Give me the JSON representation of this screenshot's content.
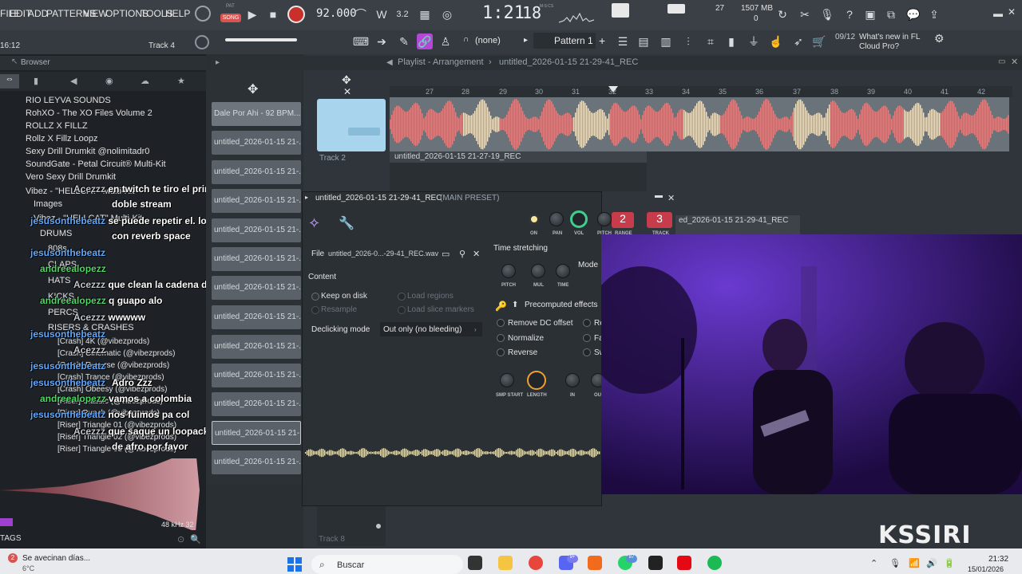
{
  "menu": {
    "items": [
      "FILE",
      "EDIT",
      "ADD",
      "PATTERNS",
      "VIEW",
      "OPTIONS",
      "TOOLS",
      "HELP"
    ],
    "song_mode": "SONG",
    "pat_label": "PAT",
    "tempo": "92.000",
    "time": "1:21",
    "time_ms": "18",
    "time_unit": "M:S:CS",
    "cpu_num": "27",
    "mem": "1507 MB",
    "mem2": "0",
    "hint_counter": "09/12",
    "hint_text": "What's new in FL Cloud Pro?"
  },
  "toolbar2": {
    "left_time": "16:12",
    "track_label": "Track 4",
    "snap": "(none)",
    "pattern": "Pattern 1"
  },
  "browser": {
    "title": "Browser",
    "items": [
      "RIO LEYVA SOUNDS",
      "RohXO - The XO Files Volume 2",
      "ROLLZ X FILLZ",
      "Rollz X Fillz Loopz",
      "Sexy Drill Drumkit @nolimitadr0",
      "SoundGate - Petal Circuit® Multi-Kit",
      "Vero Sexy Drill Drumkit",
      "Vibez - \"HELLCAT\" Multi-Kit",
      "Images",
      "Vibez - \"HELLCAT\" Multi-Kit",
      "DRUMS",
      "808s",
      "CLAPS",
      "HATS",
      "KICKS",
      "PERCS",
      "RISERS & CRASHES",
      "[Crash] 4K (@vibezprods)",
      "[Crash] Cinematic (@vibezprods)",
      "[Crash] Reverse (@vibezprods)",
      "[Crash] Trance (@vibezprods)",
      "[Crash] Obeesy (@vibezprods)",
      "[Riser] Classic (@vibezprods)",
      "[Riser] Punch (@vibezprods)",
      "[Riser] Triangle 01 (@vibezprods)",
      "[Riser] Triangle 02 (@vibezprods)",
      "[Riser] Triangle 03 (@vibezprods)"
    ],
    "sample_rate": "48 kHz 32",
    "tags_label": "TAGS"
  },
  "chat": [
    {
      "user": "Acezzz",
      "msg": "en twitch te tiro el prime si haces"
    },
    {
      "user": "",
      "msg": "doble stream"
    },
    {
      "user": "jesusonthebeatz",
      "msg": "se puede repetir el. lol lo hacias"
    },
    {
      "user": "",
      "msg": "con reverb space"
    },
    {
      "user": "jesusonthebeatz",
      "msg": ""
    },
    {
      "user": "andreealopezz",
      "msg": ""
    },
    {
      "user": "Acezzz",
      "msg": "que clean la cadena de voz"
    },
    {
      "user": "andreealopezz",
      "msg": "q guapo alo"
    },
    {
      "user": "Acezzz",
      "msg": "wwwww"
    },
    {
      "user": "jesusonthebeatz",
      "msg": ""
    },
    {
      "user": "Acezzz",
      "msg": ""
    },
    {
      "user": "jesusonthebeatz",
      "msg": ""
    },
    {
      "user": "jesusonthebeatz",
      "msg": "Adro Zzz"
    },
    {
      "user": "andreealopezz",
      "msg": "vamos a colombia"
    },
    {
      "user": "jesusonthebeatz",
      "msg": "nos fuimos pa col"
    },
    {
      "user": "Acezzz",
      "msg": "que saque un loopack de guitarras"
    },
    {
      "user": "",
      "msg": "de afro por favor"
    }
  ],
  "channels": [
    "Dale Por Ahi - 92 BPM...",
    "untitled_2026-01-15 21-...",
    "untitled_2026-01-15 21-...",
    "untitled_2026-01-15 21-...",
    "untitled_2026-01-15 21-...",
    "untitled_2026-01-15 21-...",
    "untitled_2026-01-15 21-...",
    "untitled_2026-01-15 21-...",
    "untitled_2026-01-15 21-...",
    "untitled_2026-01-15 21-...",
    "untitled_2026-01-15 21-...",
    "untitled_2026-01-15 21-...",
    "untitled_2026-01-15 21-..."
  ],
  "playlist": {
    "breadcrumb": "Playlist - Arrangement",
    "file": "untitled_2026-01-15 21-29-41_REC",
    "ticks": [
      "27",
      "28",
      "29",
      "30",
      "31",
      "32",
      "33",
      "34",
      "35",
      "36",
      "37",
      "38",
      "39",
      "40",
      "41",
      "42"
    ],
    "track2": "Track 2",
    "track8": "Track 8",
    "clip1": "untitled_2026-01-15 21-27-19_REC",
    "clip2": "ed_2026-01-15 21-29-41_REC"
  },
  "sampler": {
    "title": "untitled_2026-01-15 21-29-41_REC",
    "preset": "(MAIN PRESET)",
    "knobs": [
      "ON",
      "PAN",
      "VOL",
      "PITCH",
      "RANGE",
      "TRACK"
    ],
    "range_val": "2",
    "track_val": "3",
    "file_label": "File",
    "file_name": "untitled_2026-0...-29-41_REC.wav",
    "time_stretching": "Time stretching",
    "ts_knobs": [
      "PITCH",
      "MUL",
      "TIME"
    ],
    "mode_label": "Mode",
    "content": "Content",
    "keep_on_disk": "Keep on disk",
    "resample": "Resample",
    "load_regions": "Load regions",
    "load_slice": "Load slice markers",
    "declicking_label": "Declicking mode",
    "declicking_val": "Out only (no bleeding)",
    "precomputed": "Precomputed effects",
    "effects": [
      "Remove DC offset",
      "Normalize",
      "Reverse"
    ],
    "effects2": [
      "Re",
      "Fa",
      "Sw"
    ],
    "bottom_knobs": [
      "SMP START",
      "LENGTH",
      "IN",
      "OU"
    ]
  },
  "overlay": {
    "brand": "KSSIRI"
  },
  "taskbar": {
    "weather": "Se avecinan días...",
    "temp": "6°C",
    "search": "Buscar",
    "time": "21:32",
    "date": "15/01/2026",
    "badge_notif": "2",
    "badge_discord": "9+",
    "badge_whatsapp": "87"
  }
}
